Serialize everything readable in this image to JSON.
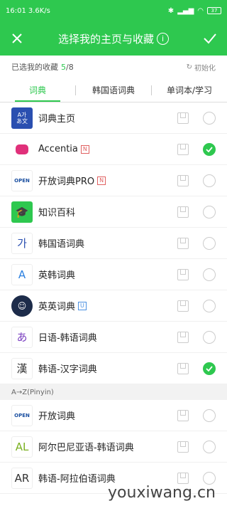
{
  "statusbar": {
    "time": "16:01",
    "speed": "3.6K/s",
    "battery": "37"
  },
  "appbar": {
    "title": "选择我的主页与收藏",
    "info": "i"
  },
  "summary": {
    "label": "已选我的收藏",
    "count": "5",
    "total": "/8",
    "reset": "初始化"
  },
  "tabs": [
    {
      "label": "词典"
    },
    {
      "label": "韩国语词典"
    },
    {
      "label": "单词本/学习"
    }
  ],
  "items": [
    {
      "label": "词典主页",
      "icon_text": "A가\nあ文",
      "checked": false
    },
    {
      "label": "Accentia",
      "badge": "N",
      "checked": true
    },
    {
      "label": "开放词典PRO",
      "badge": "N",
      "icon_text": "OPEN",
      "checked": false
    },
    {
      "label": "知识百科",
      "checked": false
    },
    {
      "label": "韩国语词典",
      "icon_text": "가",
      "checked": false
    },
    {
      "label": "英韩词典",
      "icon_text": "A",
      "checked": false
    },
    {
      "label": "英英词典",
      "badge": "U",
      "checked": false
    },
    {
      "label": "日语-韩语词典",
      "icon_text": "あ",
      "checked": false
    },
    {
      "label": "韩语-汉字词典",
      "icon_text": "漢",
      "checked": true
    }
  ],
  "section": "A→Z(Pinyin)",
  "items2": [
    {
      "label": "开放词典",
      "icon_text": "OPEN",
      "checked": false
    },
    {
      "label": "阿尔巴尼亚语-韩语词典",
      "icon_text": "AL",
      "checked": false
    },
    {
      "label": "韩语-阿拉伯语词典",
      "icon_text": "AR",
      "checked": false
    }
  ],
  "watermark": "youxiwang.cn",
  "colors": {
    "accent": "#2ec84f"
  }
}
